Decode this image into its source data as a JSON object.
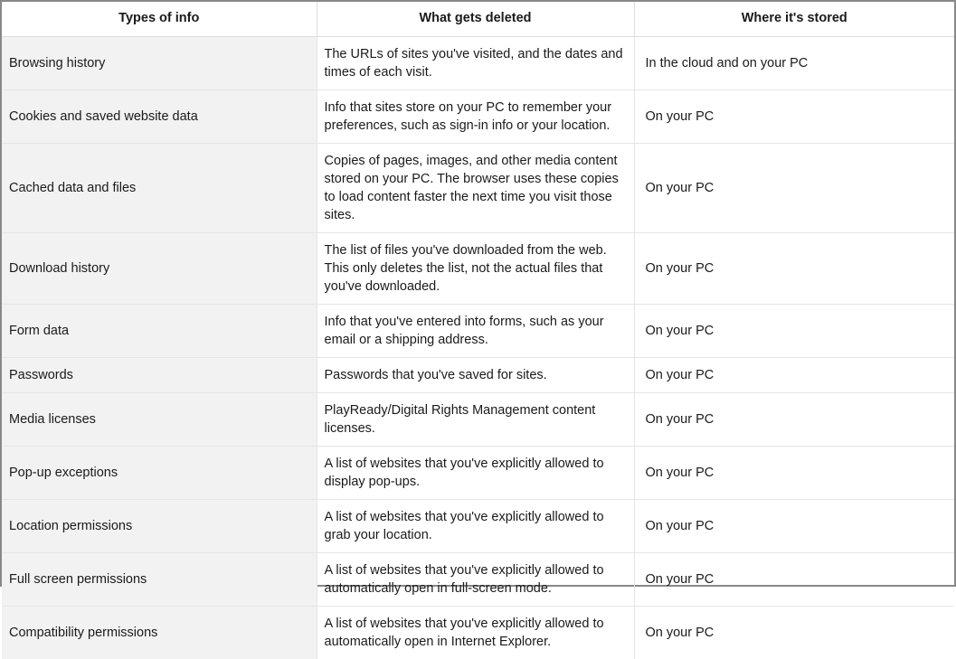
{
  "headers": {
    "col1": "Types of info",
    "col2": "What gets deleted",
    "col3": "Where it's stored"
  },
  "rows": [
    {
      "type": "Browsing history",
      "what": "The URLs of sites you've visited, and the dates and times of each visit.",
      "where": "In the cloud and on your PC"
    },
    {
      "type": "Cookies and saved website data",
      "what": "Info that sites store on your PC to remember your preferences, such as sign-in info or your location.",
      "where": "On your PC"
    },
    {
      "type": "Cached data and files",
      "what": "Copies of pages, images, and other media content stored on your PC. The browser uses these copies to load content faster the next time you visit those sites.",
      "where": "On your PC"
    },
    {
      "type": "Download history",
      "what": "The list of files you've downloaded from the web. This only deletes the list, not the actual files that you've downloaded.",
      "where": "On your PC"
    },
    {
      "type": "Form data",
      "what": "Info that you've entered into forms, such as your email or a shipping address.",
      "where": "On your PC"
    },
    {
      "type": "Passwords",
      "what": "Passwords that you've saved for sites.",
      "where": "On your PC"
    },
    {
      "type": "Media licenses",
      "what": "PlayReady/Digital Rights Management content licenses.",
      "where": "On your PC"
    },
    {
      "type": "Pop-up exceptions",
      "what": "A list of websites that you've explicitly allowed to display pop-ups.",
      "where": "On your PC"
    },
    {
      "type": "Location permissions",
      "what": "A list of websites that you've explicitly allowed to grab your location.",
      "where": "On your PC"
    },
    {
      "type": "Full screen permissions",
      "what": "A list of websites that you've explicitly allowed to automatically open in full-screen mode.",
      "where": "On your PC"
    },
    {
      "type": "Compatibility permissions",
      "what": "A list of websites that you've explicitly allowed to automatically open in Internet Explorer.",
      "where": "On your PC"
    }
  ]
}
